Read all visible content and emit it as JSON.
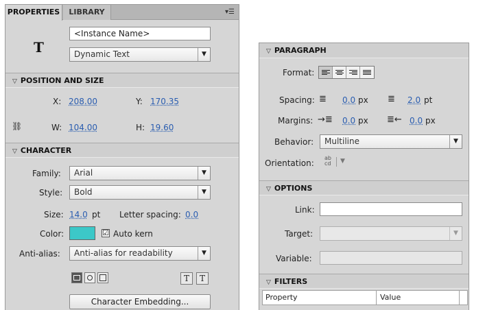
{
  "left": {
    "tabs": [
      {
        "label": "PROPERTIES",
        "active": true
      },
      {
        "label": "LIBRARY",
        "active": false
      }
    ],
    "instance_name_placeholder": "<Instance Name>",
    "text_type": "Dynamic Text",
    "symbol_glyph": "T",
    "position_size": {
      "header": "POSITION AND SIZE",
      "x_label": "X:",
      "x_value": "208.00",
      "y_label": "Y:",
      "y_value": "170.35",
      "w_label": "W:",
      "w_value": "104.00",
      "h_label": "H:",
      "h_value": "19.60"
    },
    "character": {
      "header": "CHARACTER",
      "family_label": "Family:",
      "family_value": "Arial",
      "style_label": "Style:",
      "style_value": "Bold",
      "size_label": "Size:",
      "size_value": "14.0",
      "size_unit": "pt",
      "letter_spacing_label": "Letter spacing:",
      "letter_spacing_value": "0.0",
      "color_label": "Color:",
      "color_value": "#3cc8c8",
      "auto_kern_label": "Auto kern",
      "auto_kern_checked": "☑",
      "anti_alias_label": "Anti-alias:",
      "anti_alias_value": "Anti-alias for readability",
      "embed_button": "Character Embedding..."
    }
  },
  "right": {
    "paragraph": {
      "header": "PARAGRAPH",
      "format_label": "Format:",
      "spacing_label": "Spacing:",
      "indent_value": "0.0",
      "indent_unit": "px",
      "line_spacing_value": "2.0",
      "line_spacing_unit": "pt",
      "margins_label": "Margins:",
      "left_margin_value": "0.0",
      "left_margin_unit": "px",
      "right_margin_value": "0.0",
      "right_margin_unit": "px",
      "behavior_label": "Behavior:",
      "behavior_value": "Multiline",
      "orientation_label": "Orientation:"
    },
    "options": {
      "header": "OPTIONS",
      "link_label": "Link:",
      "link_value": "",
      "target_label": "Target:",
      "target_value": "",
      "variable_label": "Variable:",
      "variable_value": ""
    },
    "filters": {
      "header": "FILTERS",
      "columns": [
        "Property",
        "Value"
      ]
    }
  }
}
